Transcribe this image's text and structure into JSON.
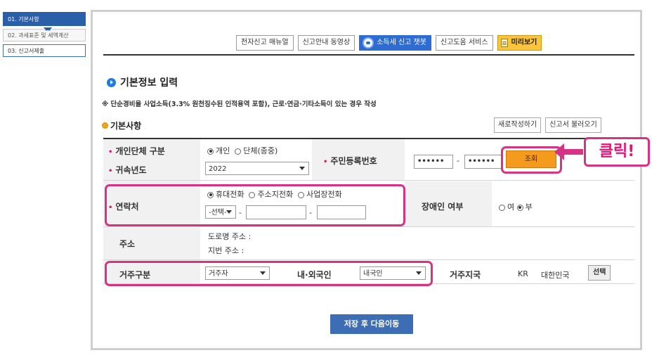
{
  "steps": [
    {
      "label": "01. 기본사항"
    },
    {
      "label": "02. 과세표준 및 세액계산"
    },
    {
      "label": "03. 신고서제출"
    }
  ],
  "toolbar": {
    "manual": "전자신고 매뉴얼",
    "video": "신고안내 동영상",
    "chatbot": "소득세 신고 챗봇",
    "help": "신고도움 서비스",
    "preview": "미리보기"
  },
  "section": {
    "title": "기본정보 입력",
    "note": "※ 단순경비율 사업소득(3.3% 원천징수된 인적용역 포함), 근로·연금·기타소득이 있는 경우 작성",
    "subtitle": "기본사항",
    "new_button": "새로작성하기",
    "load_button": "신고서 불러오기"
  },
  "form": {
    "type_label": "개인단체 구분",
    "type_options": [
      "개인",
      "단체(종중)"
    ],
    "type_selected": "개인",
    "year_label": "귀속년도",
    "year_value": "2022",
    "rrn_label": "주민등록번호",
    "rrn_first": "••••••",
    "rrn_dash": "-",
    "rrn_second": "••••••",
    "lookup_button": "조회",
    "contact_label": "연락처",
    "contact_options": [
      "휴대전화",
      "주소지전화",
      "사업장전화"
    ],
    "contact_selected": "휴대전화",
    "contact_prefix": "-선택-",
    "dash": "-",
    "disabled_label": "장애인 여부",
    "disabled_options": [
      "여",
      "부"
    ],
    "disabled_selected": "부",
    "address_label": "주소",
    "road_address": "도로명 주소 :",
    "lot_address": "지번 주소 :",
    "residence_label": "거주구분",
    "residence_value": "거주자",
    "nationality_label": "내·외국인",
    "nationality_value": "내국인",
    "region_label": "거주지국",
    "region_code": "KR",
    "region_name": "대한민국",
    "region_button": "선택"
  },
  "callout": {
    "text": "클릭!"
  },
  "save_button": "저장 후 다음이동",
  "colors": {
    "primary": "#2a5faa",
    "highlight": "#d63384",
    "orange": "#f49a1d",
    "required": "#e0156d"
  }
}
